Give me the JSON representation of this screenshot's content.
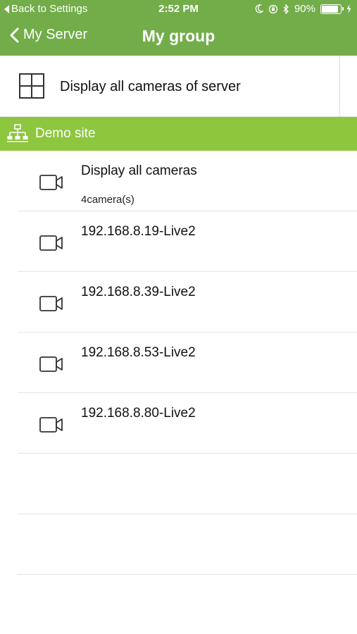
{
  "status_bar": {
    "back_label": "Back to Settings",
    "time": "2:52 PM",
    "battery_percent": "90%",
    "battery_level": 0.9
  },
  "nav": {
    "back_label": "My Server",
    "title": "My group"
  },
  "server_row": {
    "label": "Display all cameras of server"
  },
  "site": {
    "label": "Demo site",
    "color": "#8dc63f"
  },
  "cameras": [
    {
      "title": "Display all cameras",
      "subtitle": "4camera(s)"
    },
    {
      "title": "192.168.8.19-Live2"
    },
    {
      "title": "192.168.8.39-Live2"
    },
    {
      "title": "192.168.8.53-Live2"
    },
    {
      "title": "192.168.8.80-Live2"
    }
  ],
  "theme": {
    "nav_green": "#72ad4a",
    "site_green": "#8dc63f"
  }
}
